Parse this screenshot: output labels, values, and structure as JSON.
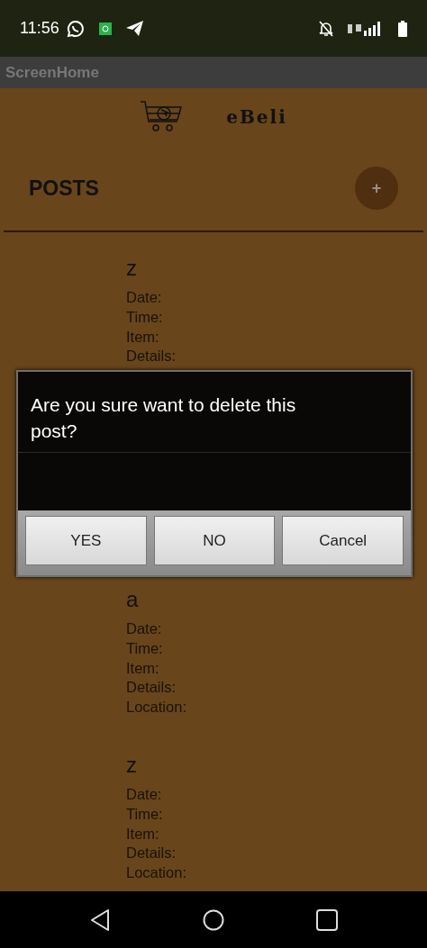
{
  "status_bar": {
    "time": "11:56"
  },
  "app_bar": {
    "title": "ScreenHome"
  },
  "header": {
    "brand": "eBeli"
  },
  "section": {
    "title": "POSTS",
    "add_button": "+"
  },
  "posts": [
    {
      "title": "z",
      "fields": [
        "Date:",
        "Time:",
        "Item:",
        "Details:"
      ]
    },
    {
      "title": "a",
      "fields": [
        "Date:",
        "Time:",
        "Item:",
        "Details:",
        "Location:"
      ]
    },
    {
      "title": "z",
      "fields": [
        "Date:",
        "Time:",
        "Item:",
        "Details:",
        "Location:"
      ]
    }
  ],
  "dialog": {
    "message": "Are you sure want to delete this post?",
    "buttons": [
      "YES",
      "NO",
      "Cancel"
    ]
  }
}
